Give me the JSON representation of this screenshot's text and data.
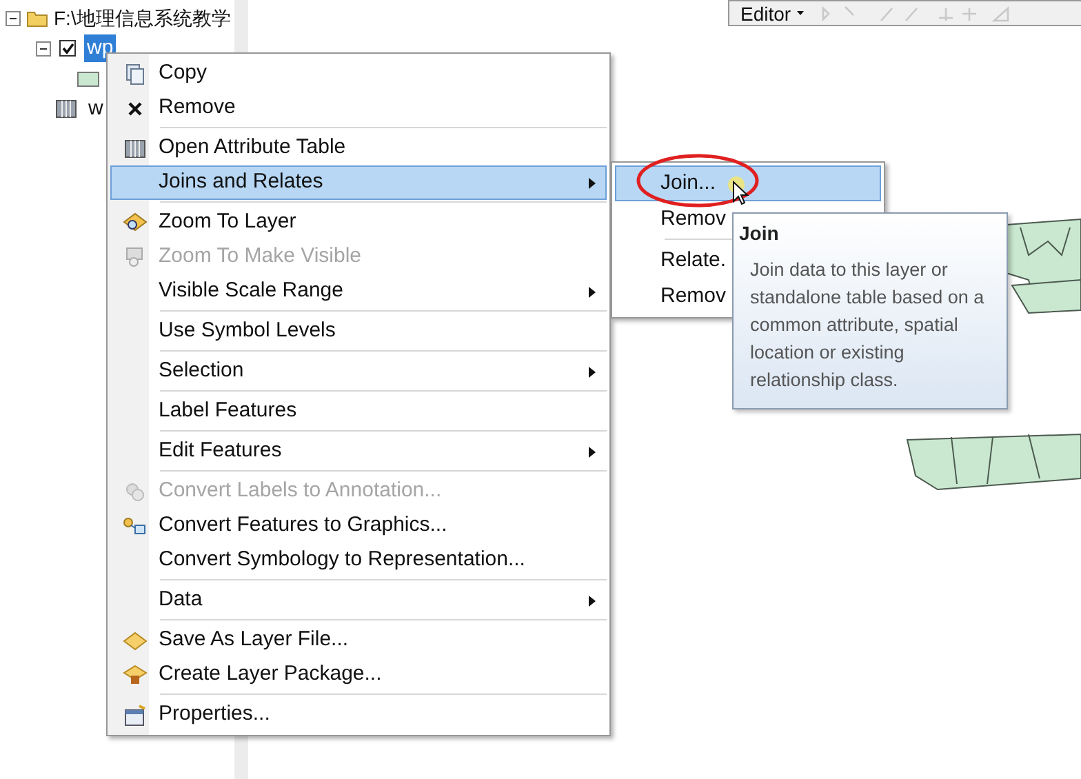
{
  "toc": {
    "items": [
      {
        "kind": "folder",
        "label": "F:\\地理信息系统教学",
        "expanded": true
      },
      {
        "kind": "layer",
        "label": "wp",
        "checked": true,
        "selected": true,
        "expanded": true
      },
      {
        "kind": "patch"
      },
      {
        "kind": "table",
        "label": "w"
      }
    ]
  },
  "toolbar": {
    "label": "Editor"
  },
  "context_menu": {
    "items": [
      {
        "kind": "copy",
        "label": "Copy",
        "disabled": false,
        "submenu": false,
        "selected": false
      },
      {
        "kind": "remove",
        "label": "Remove",
        "disabled": false,
        "submenu": false,
        "selected": false
      },
      {
        "kind": "separator"
      },
      {
        "kind": "table",
        "label": "Open Attribute Table",
        "disabled": false,
        "submenu": false,
        "selected": false
      },
      {
        "kind": "plain",
        "label": "Joins and Relates",
        "disabled": false,
        "submenu": true,
        "selected": true
      },
      {
        "kind": "separator"
      },
      {
        "kind": "zoom",
        "label": "Zoom To Layer",
        "disabled": false,
        "submenu": false,
        "selected": false
      },
      {
        "kind": "zoomvisible",
        "label": "Zoom To Make Visible",
        "disabled": true,
        "submenu": false,
        "selected": false
      },
      {
        "kind": "plain",
        "label": "Visible Scale Range",
        "disabled": false,
        "submenu": true,
        "selected": false
      },
      {
        "kind": "separator"
      },
      {
        "kind": "plain",
        "label": "Use Symbol Levels",
        "disabled": false,
        "submenu": false,
        "selected": false
      },
      {
        "kind": "separator"
      },
      {
        "kind": "plain",
        "label": "Selection",
        "disabled": false,
        "submenu": true,
        "selected": false
      },
      {
        "kind": "separator"
      },
      {
        "kind": "plain",
        "label": "Label Features",
        "disabled": false,
        "submenu": false,
        "selected": false
      },
      {
        "kind": "separator"
      },
      {
        "kind": "plain",
        "label": "Edit Features",
        "disabled": false,
        "submenu": true,
        "selected": false
      },
      {
        "kind": "separator"
      },
      {
        "kind": "labels",
        "label": "Convert Labels to Annotation...",
        "disabled": true,
        "submenu": false,
        "selected": false
      },
      {
        "kind": "graphics",
        "label": "Convert Features to Graphics...",
        "disabled": false,
        "submenu": false,
        "selected": false
      },
      {
        "kind": "plain",
        "label": "Convert Symbology to Representation...",
        "disabled": false,
        "submenu": false,
        "selected": false
      },
      {
        "kind": "separator"
      },
      {
        "kind": "plain",
        "label": "Data",
        "disabled": false,
        "submenu": true,
        "selected": false
      },
      {
        "kind": "separator"
      },
      {
        "kind": "layerfile",
        "label": "Save As Layer File...",
        "disabled": false,
        "submenu": false,
        "selected": false
      },
      {
        "kind": "package",
        "label": "Create Layer Package...",
        "disabled": false,
        "submenu": false,
        "selected": false
      },
      {
        "kind": "separator"
      },
      {
        "kind": "properties",
        "label": "Properties...",
        "disabled": false,
        "submenu": false,
        "selected": false
      }
    ]
  },
  "submenu": {
    "items": [
      {
        "kind": "item",
        "label": "Join...",
        "selected": true
      },
      {
        "kind": "item",
        "label": "Remov",
        "selected": false
      },
      {
        "kind": "separator"
      },
      {
        "kind": "item",
        "label": "Relate.",
        "selected": false
      },
      {
        "kind": "item",
        "label": "Remov",
        "selected": false
      }
    ]
  },
  "tooltip": {
    "title": "Join",
    "text": "Join data to this layer or standalone table based on a common attribute, spatial location or existing relationship class."
  }
}
